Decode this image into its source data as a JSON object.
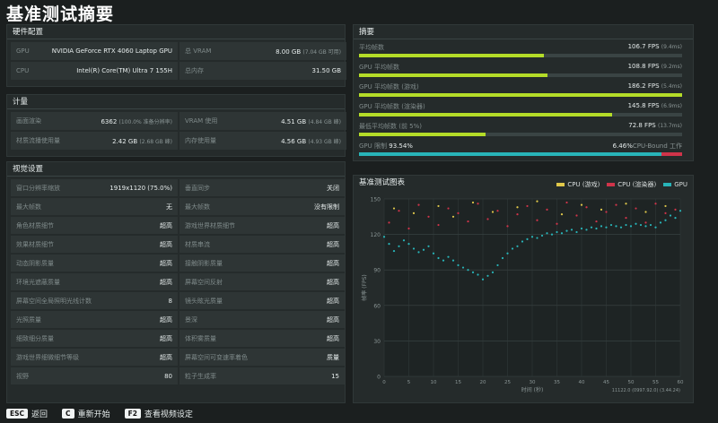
{
  "title": "基准测试摘要",
  "hardware": {
    "header": "硬件配置",
    "rows": [
      {
        "label": "GPU",
        "value": "NVIDIA GeForce RTX 4060 Laptop GPU",
        "sub": ""
      },
      {
        "label": "总 VRAM",
        "value": "8.00 GB",
        "sub": "(7.04 GB 可用)"
      },
      {
        "label": "CPU",
        "value": "Intel(R) Core(TM) Ultra 7 155H",
        "sub": ""
      },
      {
        "label": "总内存",
        "value": "31.50 GB",
        "sub": ""
      }
    ]
  },
  "metrics": {
    "header": "计量",
    "rows": [
      {
        "label": "画面渲染",
        "value": "6362",
        "sub": "(100.0% 准备分辨率)"
      },
      {
        "label": "VRAM 使用",
        "value": "4.51 GB",
        "sub": "(4.84 GB 峰)"
      },
      {
        "label": "材质流播使用量",
        "value": "2.42 GB",
        "sub": "(2.68 GB 峰)"
      },
      {
        "label": "内存使用量",
        "value": "4.56 GB",
        "sub": "(4.93 GB 峰)"
      }
    ]
  },
  "visual": {
    "header": "视觉设置",
    "rows": [
      {
        "label": "窗口分辨率缩放",
        "value": "1919x1120 (75.0%)"
      },
      {
        "label": "垂直同步",
        "value": "关闭"
      },
      {
        "label": "最大帧数",
        "value": "无"
      },
      {
        "label": "最大帧数",
        "value": "没有限制"
      },
      {
        "label": "角色材质细节",
        "value": "超高"
      },
      {
        "label": "游戏世界材质细节",
        "value": "超高"
      },
      {
        "label": "效果材质细节",
        "value": "超高"
      },
      {
        "label": "材质串流",
        "value": "超高"
      },
      {
        "label": "动态阴影质量",
        "value": "超高"
      },
      {
        "label": "接触阴影质量",
        "value": "超高"
      },
      {
        "label": "环境光遮蔽质量",
        "value": "超高"
      },
      {
        "label": "屏幕空间反射",
        "value": "超高"
      },
      {
        "label": "屏幕空间全局照明光线计数",
        "value": "8"
      },
      {
        "label": "镜头眩光质量",
        "value": "超高"
      },
      {
        "label": "光照质量",
        "value": "超高"
      },
      {
        "label": "景深",
        "value": "超高"
      },
      {
        "label": "细致细分质量",
        "value": "超高"
      },
      {
        "label": "体积雾质量",
        "value": "超高"
      },
      {
        "label": "游戏世界细微细节等级",
        "value": "超高"
      },
      {
        "label": "屏幕空间可变速率着色",
        "value": "质量"
      },
      {
        "label": "视野",
        "value": "80"
      },
      {
        "label": "粒子生成率",
        "value": "15"
      }
    ]
  },
  "summary": {
    "header": "摘要",
    "rows": [
      {
        "label": "平均帧数",
        "value": "106.7 FPS",
        "sub": "(9.4ms)",
        "fill": 0.573
      },
      {
        "label": "GPU 平均帧数",
        "value": "108.8 FPS",
        "sub": "(9.2ms)",
        "fill": 0.584
      },
      {
        "label": "GPU 平均帧数 (游戏)",
        "value": "186.2 FPS",
        "sub": "(5.4ms)",
        "fill": 1.0
      },
      {
        "label": "GPU 平均帧数 (渲染器)",
        "value": "145.8 FPS",
        "sub": "(6.9ms)",
        "fill": 0.783
      },
      {
        "label": "最低平均帧数 (前 5%)",
        "value": "72.8 FPS",
        "sub": "(13.7ms)",
        "fill": 0.391
      }
    ],
    "bound": {
      "left_label": "GPU 限制",
      "left_value": "93.54%",
      "right_value": "6.46%",
      "right_label": "CPU-Bound 工作",
      "fraction": 0.9354
    }
  },
  "chart_panel": {
    "header": "基准测试图表"
  },
  "chart_data": {
    "type": "scatter",
    "xlabel": "时间 (秒)",
    "ylabel": "帧率 (FPS)",
    "xlim": [
      0,
      60
    ],
    "ylim": [
      0,
      150
    ],
    "x_ticks": [
      0,
      5,
      10,
      15,
      20,
      25,
      30,
      35,
      40,
      45,
      50,
      55,
      60
    ],
    "y_ticks": [
      0,
      30,
      60,
      90,
      120,
      150
    ],
    "footnote": "11122.0 (0997.92.0) (3.44.24)",
    "legend_position": "top-right",
    "series": [
      {
        "name": "CPU (游戏)",
        "color": "#e0c84a",
        "points": [
          [
            2,
            142
          ],
          [
            6,
            138
          ],
          [
            11,
            144
          ],
          [
            14,
            135
          ],
          [
            18,
            147
          ],
          [
            22,
            139
          ],
          [
            27,
            143
          ],
          [
            31,
            148
          ],
          [
            36,
            137
          ],
          [
            40,
            145
          ],
          [
            44,
            141
          ],
          [
            49,
            146
          ],
          [
            53,
            139
          ],
          [
            57,
            144
          ]
        ]
      },
      {
        "name": "CPU (渲染器)",
        "color": "#d0344a",
        "points": [
          [
            1,
            130
          ],
          [
            3,
            140
          ],
          [
            5,
            125
          ],
          [
            7,
            145
          ],
          [
            9,
            135
          ],
          [
            11,
            128
          ],
          [
            13,
            142
          ],
          [
            15,
            138
          ],
          [
            17,
            131
          ],
          [
            19,
            146
          ],
          [
            21,
            133
          ],
          [
            23,
            140
          ],
          [
            25,
            127
          ],
          [
            27,
            137
          ],
          [
            29,
            144
          ],
          [
            31,
            132
          ],
          [
            33,
            141
          ],
          [
            35,
            129
          ],
          [
            37,
            147
          ],
          [
            39,
            136
          ],
          [
            41,
            143
          ],
          [
            43,
            131
          ],
          [
            45,
            139
          ],
          [
            47,
            145
          ],
          [
            49,
            134
          ],
          [
            51,
            142
          ],
          [
            53,
            130
          ],
          [
            55,
            146
          ],
          [
            57,
            138
          ],
          [
            59,
            141
          ]
        ]
      },
      {
        "name": "GPU",
        "color": "#28b4b8",
        "points": [
          [
            0,
            118
          ],
          [
            1,
            112
          ],
          [
            2,
            106
          ],
          [
            3,
            110
          ],
          [
            4,
            115
          ],
          [
            5,
            112
          ],
          [
            6,
            108
          ],
          [
            7,
            105
          ],
          [
            8,
            107
          ],
          [
            9,
            110
          ],
          [
            10,
            104
          ],
          [
            11,
            100
          ],
          [
            12,
            98
          ],
          [
            13,
            101
          ],
          [
            14,
            98
          ],
          [
            15,
            94
          ],
          [
            16,
            92
          ],
          [
            17,
            90
          ],
          [
            18,
            88
          ],
          [
            19,
            86
          ],
          [
            20,
            82
          ],
          [
            21,
            85
          ],
          [
            22,
            88
          ],
          [
            23,
            94
          ],
          [
            24,
            100
          ],
          [
            25,
            104
          ],
          [
            26,
            108
          ],
          [
            27,
            110
          ],
          [
            28,
            114
          ],
          [
            29,
            116
          ],
          [
            30,
            118
          ],
          [
            31,
            117
          ],
          [
            32,
            119
          ],
          [
            33,
            121
          ],
          [
            34,
            120
          ],
          [
            35,
            122
          ],
          [
            36,
            121
          ],
          [
            37,
            123
          ],
          [
            38,
            124
          ],
          [
            39,
            122
          ],
          [
            40,
            125
          ],
          [
            41,
            124
          ],
          [
            42,
            126
          ],
          [
            43,
            125
          ],
          [
            44,
            127
          ],
          [
            45,
            126
          ],
          [
            46,
            128
          ],
          [
            47,
            127
          ],
          [
            48,
            126
          ],
          [
            49,
            128
          ],
          [
            50,
            127
          ],
          [
            51,
            129
          ],
          [
            52,
            128
          ],
          [
            53,
            127
          ],
          [
            54,
            128
          ],
          [
            55,
            126
          ],
          [
            56,
            130
          ],
          [
            57,
            132
          ],
          [
            58,
            136
          ],
          [
            59,
            134
          ],
          [
            60,
            140
          ]
        ]
      }
    ]
  },
  "footer": {
    "esc_key": "ESC",
    "esc_label": "返回",
    "c_key": "C",
    "c_label": "重新开始",
    "f2_key": "F2",
    "f2_label": "查看视频设定"
  }
}
